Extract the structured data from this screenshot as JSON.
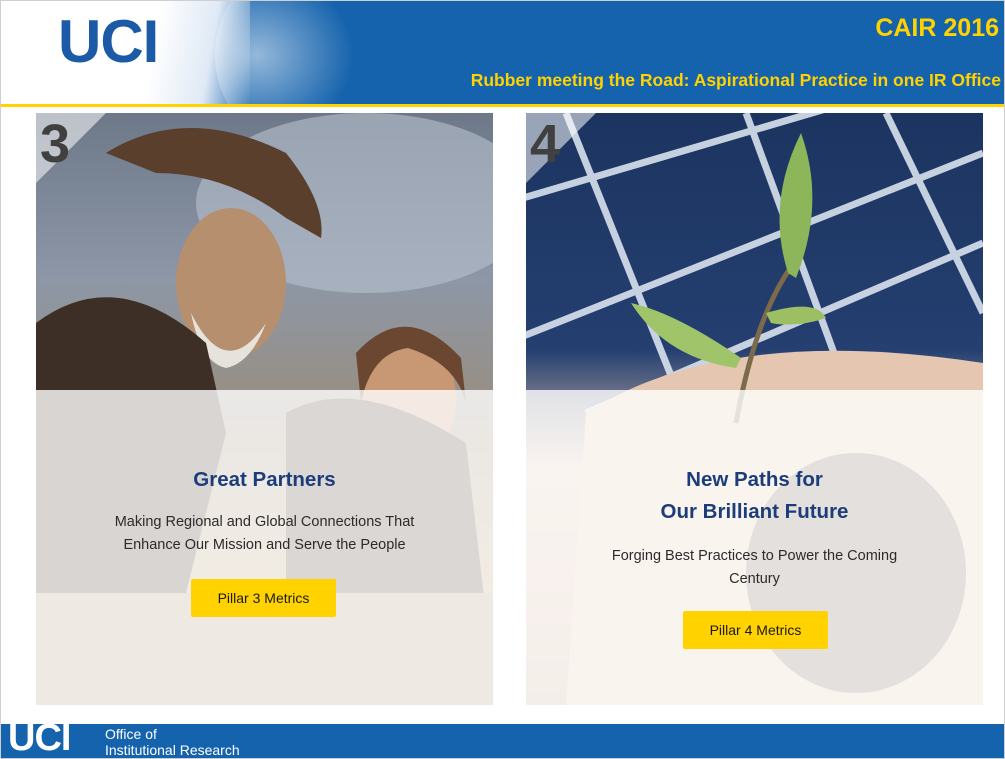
{
  "header": {
    "logo_text": "UCI",
    "event_title": "CAIR 2016",
    "subtitle": "Rubber meeting the Road: Aspirational Practice in one IR Office"
  },
  "cards": [
    {
      "number": "3",
      "title_lines": [
        "Great Partners"
      ],
      "description_lines": [
        "Making Regional and Global Connections That",
        "Enhance Our Mission and Serve the People"
      ],
      "button_label": "Pillar 3 Metrics",
      "image": "photo-researchers-outdoors"
    },
    {
      "number": "4",
      "title_lines": [
        "New Paths for",
        "Our Brilliant Future"
      ],
      "description_lines": [
        "Forging Best Practices to Power the Coming",
        "Century"
      ],
      "button_label": "Pillar 4 Metrics",
      "image": "photo-seedling-over-solar-panel"
    }
  ],
  "footer": {
    "logo_text": "UCI",
    "line1": "Office of",
    "line2": "Institutional Research"
  },
  "colors": {
    "brand_blue": "#1563ad",
    "brand_gold": "#ffd200",
    "title_navy": "#1c3d7a"
  }
}
